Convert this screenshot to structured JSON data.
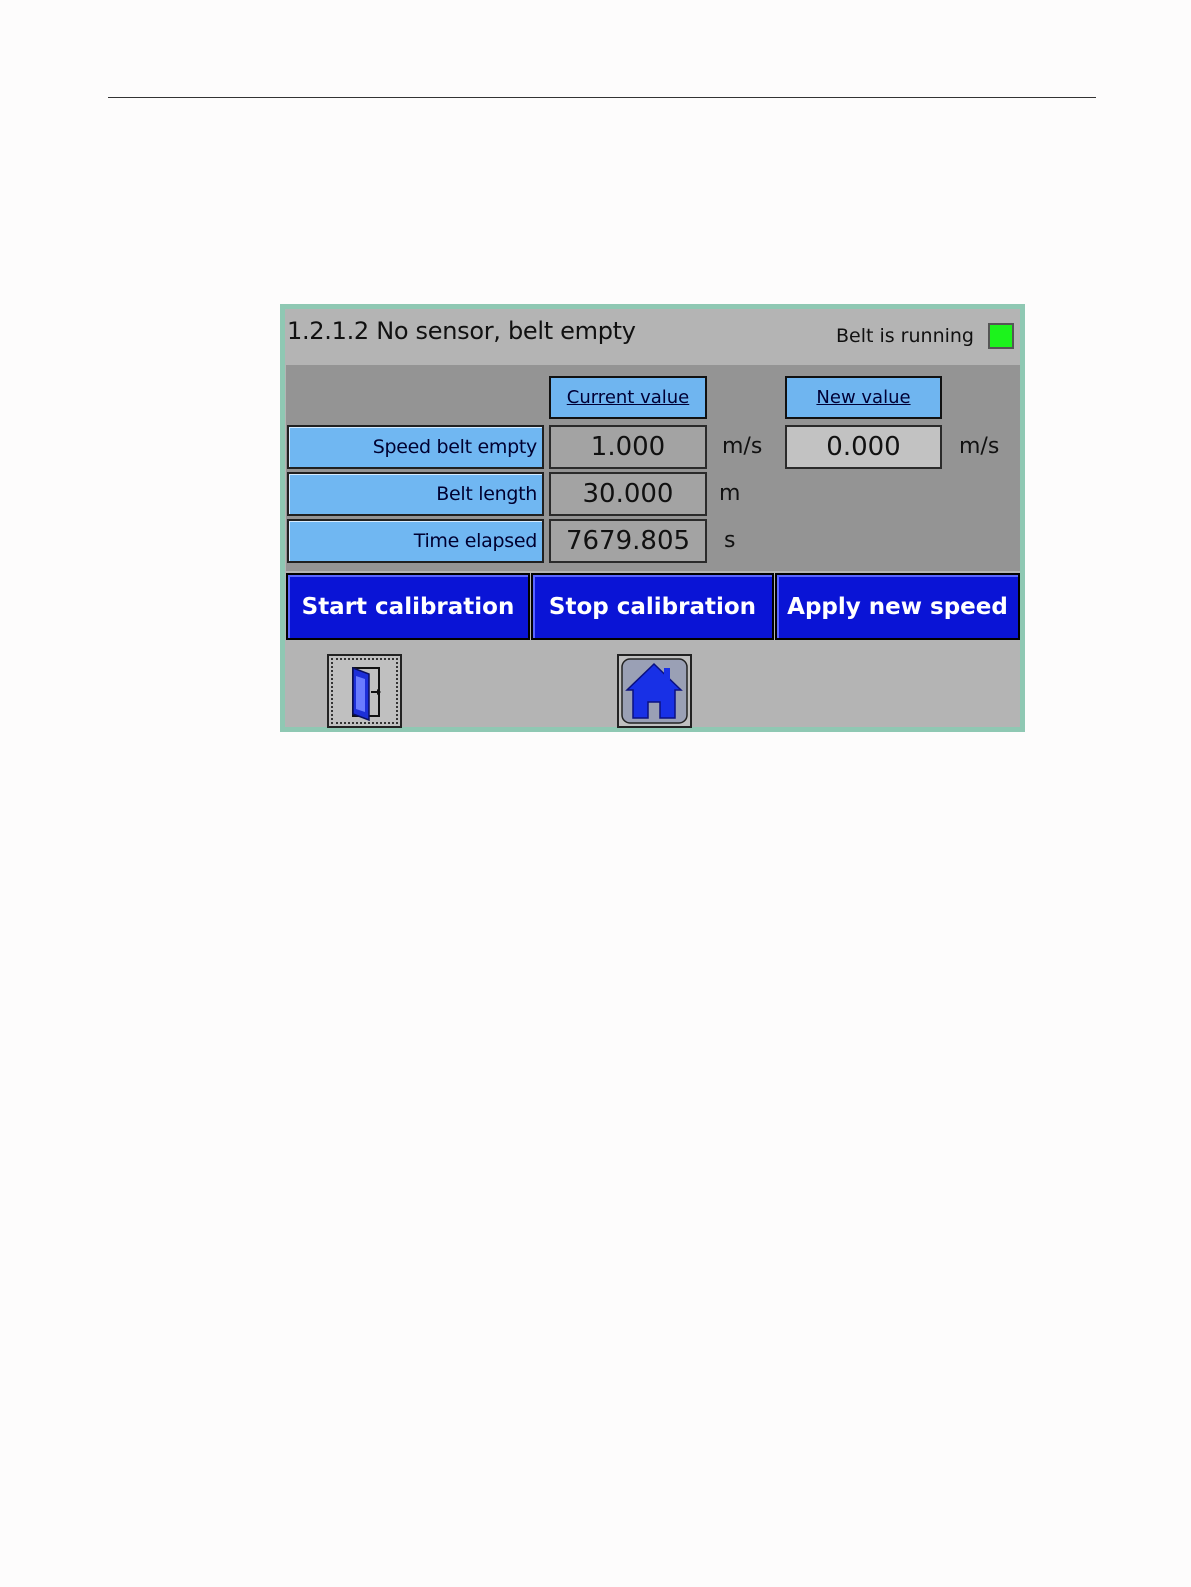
{
  "window": {
    "title": "1.2.1.2 No sensor, belt empty",
    "status_label": "Belt is running",
    "status_color": "#1cf31c"
  },
  "columns": {
    "current": "Current value",
    "new": "New value"
  },
  "rows": [
    {
      "label": "Speed belt empty",
      "current": "1.000",
      "unit": "m/s",
      "new": "0.000",
      "new_unit": "m/s"
    },
    {
      "label": "Belt length",
      "current": "30.000",
      "unit": "m"
    },
    {
      "label": "Time elapsed",
      "current": "7679.805",
      "unit": "s"
    }
  ],
  "buttons": {
    "start": "Start calibration",
    "stop": "Stop calibration",
    "apply": "Apply new speed"
  },
  "nav": {
    "exit_icon": "exit-door-icon",
    "home_icon": "home-icon"
  },
  "colors": {
    "button_blue": "#0a14d6",
    "label_blue": "#70b7f2"
  }
}
